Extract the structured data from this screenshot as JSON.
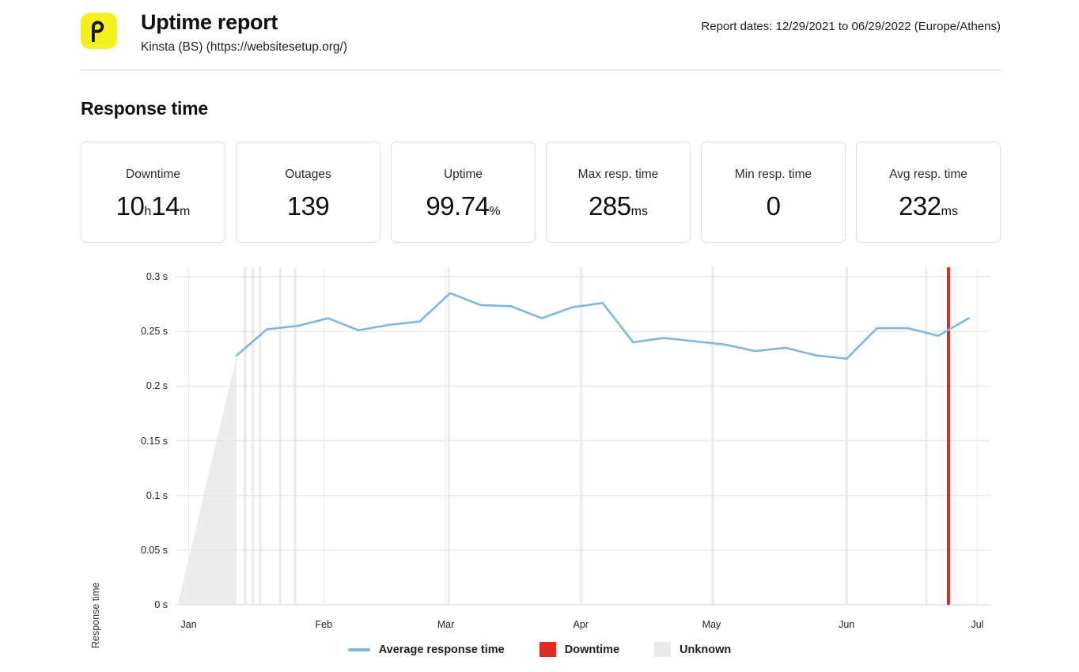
{
  "header": {
    "logo_icon": "pingdom-p-logo-icon",
    "logo_letter": "p",
    "logo_color": "#f5f11f",
    "title": "Uptime report",
    "subtitle": "Kinsta (BS) (https://websitesetup.org/)",
    "report_dates": "Report dates: 12/29/2021 to 06/29/2022 (Europe/Athens)"
  },
  "section": {
    "title": "Response time"
  },
  "cards": [
    {
      "label": "Downtime",
      "value": "10",
      "unit": "h",
      "value2": "14",
      "unit2": "m"
    },
    {
      "label": "Outages",
      "value": "139",
      "unit": ""
    },
    {
      "label": "Uptime",
      "value": "99.74",
      "unit": "%"
    },
    {
      "label": "Max resp. time",
      "value": "285",
      "unit": "ms"
    },
    {
      "label": "Min resp. time",
      "value": "0",
      "unit": ""
    },
    {
      "label": "Avg resp. time",
      "value": "232",
      "unit": "ms"
    }
  ],
  "chart_data": {
    "type": "line",
    "title": "Response time",
    "xlabel": "",
    "ylabel": "Response time",
    "ylim": [
      0,
      0.3
    ],
    "yticks": [
      0,
      0.05,
      0.1,
      0.15,
      0.2,
      0.25,
      0.3
    ],
    "ytick_labels": [
      "0 s",
      "0.05 s",
      "0.1 s",
      "0.15 s",
      "0.2 s",
      "0.25 s",
      "0.3 s"
    ],
    "xtick_labels": [
      "Jan",
      "Feb",
      "Mar",
      "Apr",
      "May",
      "Jun",
      "Jul"
    ],
    "xtick_positions_days": [
      3,
      34,
      62,
      93,
      123,
      154,
      184
    ],
    "x_range_days": [
      0,
      187
    ],
    "grid": true,
    "legend_position": "bottom",
    "series": [
      {
        "name": "Average response time",
        "color": "#7cb8dd",
        "points": [
          {
            "day": 14,
            "value": 0.228
          },
          {
            "day": 21,
            "value": 0.252
          },
          {
            "day": 28,
            "value": 0.255
          },
          {
            "day": 35,
            "value": 0.262
          },
          {
            "day": 42,
            "value": 0.251
          },
          {
            "day": 49,
            "value": 0.256
          },
          {
            "day": 56,
            "value": 0.259
          },
          {
            "day": 63,
            "value": 0.285
          },
          {
            "day": 70,
            "value": 0.274
          },
          {
            "day": 77,
            "value": 0.273
          },
          {
            "day": 84,
            "value": 0.262
          },
          {
            "day": 91,
            "value": 0.272
          },
          {
            "day": 98,
            "value": 0.276
          },
          {
            "day": 105,
            "value": 0.24
          },
          {
            "day": 112,
            "value": 0.244
          },
          {
            "day": 119,
            "value": 0.241
          },
          {
            "day": 126,
            "value": 0.238
          },
          {
            "day": 133,
            "value": 0.232
          },
          {
            "day": 140,
            "value": 0.235
          },
          {
            "day": 147,
            "value": 0.228
          },
          {
            "day": 154,
            "value": 0.225
          },
          {
            "day": 161,
            "value": 0.253
          },
          {
            "day": 168,
            "value": 0.253
          },
          {
            "day": 175,
            "value": 0.246
          },
          {
            "day": 182,
            "value": 0.262
          }
        ]
      }
    ],
    "downtime_bands": [
      {
        "color": "#d32f2a",
        "start_day": 177.0,
        "end_day": 177.6
      }
    ],
    "unknown_regions": [
      {
        "color": "#ececec",
        "type": "ramp",
        "start_day": 0.5,
        "end_day": 14.0
      },
      {
        "color": "#ececec",
        "type": "band",
        "start_day": 15.6,
        "end_day": 16.3
      },
      {
        "color": "#ececec",
        "type": "band",
        "start_day": 17.4,
        "end_day": 18.0
      },
      {
        "color": "#ececec",
        "type": "band",
        "start_day": 19.1,
        "end_day": 19.7
      },
      {
        "color": "#ececec",
        "type": "band",
        "start_day": 23.7,
        "end_day": 24.3
      },
      {
        "color": "#ececec",
        "type": "band",
        "start_day": 27.1,
        "end_day": 27.7
      },
      {
        "color": "#ececec",
        "type": "band",
        "start_day": 62.4,
        "end_day": 62.9
      },
      {
        "color": "#ececec",
        "type": "band",
        "start_day": 92.8,
        "end_day": 93.4
      },
      {
        "color": "#ececec",
        "type": "band",
        "start_day": 123.0,
        "end_day": 123.6
      },
      {
        "color": "#ececec",
        "type": "band",
        "start_day": 153.7,
        "end_day": 154.3
      },
      {
        "color": "#ececec",
        "type": "band",
        "start_day": 172.0,
        "end_day": 172.5
      }
    ]
  },
  "legend": [
    {
      "label": "Average response time",
      "swatch": "line",
      "color": "#7cb8dd"
    },
    {
      "label": "Downtime",
      "swatch": "box",
      "color": "#e02b23"
    },
    {
      "label": "Unknown",
      "swatch": "box",
      "color": "#eaeaea"
    }
  ]
}
